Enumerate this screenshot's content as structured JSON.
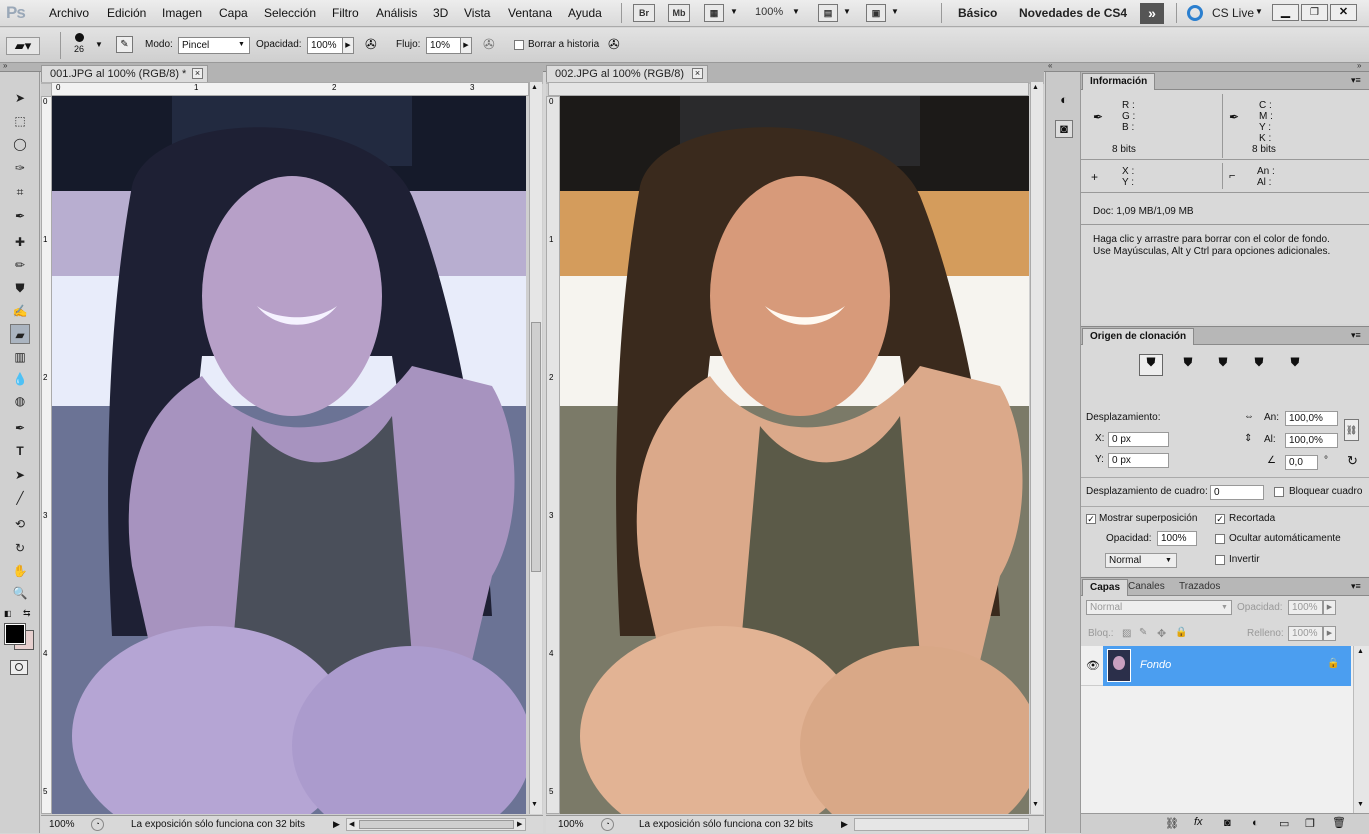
{
  "app": {
    "logo": "Ps"
  },
  "menu": [
    "Archivo",
    "Edición",
    "Imagen",
    "Capa",
    "Selección",
    "Filtro",
    "Análisis",
    "3D",
    "Vista",
    "Ventana",
    "Ayuda"
  ],
  "appbar": {
    "br_label": "Br",
    "mb_label": "Mb",
    "zoom": "100%",
    "workspace_basic": "Básico",
    "workspace_new": "Novedades de CS4",
    "cslive": "CS Live"
  },
  "options": {
    "brush_size": "26",
    "mode_label": "Modo:",
    "mode_value": "Pincel",
    "opacity_label": "Opacidad:",
    "opacity_value": "100%",
    "flow_label": "Flujo:",
    "flow_value": "10%",
    "history_label": "Borrar a historia"
  },
  "documents": [
    {
      "title": "001.JPG al 100% (RGB/8) *",
      "zoom": "100%",
      "status": "La exposición sólo funciona con 32 bits",
      "ruler_h": [
        "0",
        "1",
        "2",
        "3"
      ],
      "ruler_v": [
        "0",
        "1",
        "2",
        "3",
        "4",
        "5"
      ]
    },
    {
      "title": "002.JPG al 100% (RGB/8)",
      "zoom": "100%",
      "status": "La exposición sólo funciona con 32 bits",
      "ruler_h": [
        "0",
        "1",
        "2",
        "3"
      ],
      "ruler_v": [
        "0",
        "1",
        "2",
        "3",
        "4",
        "5"
      ]
    }
  ],
  "info_panel": {
    "tab": "Información",
    "rgb": [
      "R :",
      "G :",
      "B :"
    ],
    "bits_left": "8 bits",
    "cmyk": [
      "C :",
      "M :",
      "Y :",
      "K :"
    ],
    "bits_right": "8 bits",
    "xy": [
      "X :",
      "Y :"
    ],
    "size": [
      "An :",
      "Al :"
    ],
    "doc": "Doc: 1,09 MB/1,09 MB",
    "hint1": "Haga clic y arrastre para borrar con el color de fondo.",
    "hint2": "Use Mayúsculas, Alt y Ctrl para opciones adicionales."
  },
  "clone_panel": {
    "tab": "Origen de clonación",
    "offset_label": "Desplazamiento:",
    "x_label": "X:",
    "x_value": "0 px",
    "y_label": "Y:",
    "y_value": "0 px",
    "w_label": "An:",
    "w_value": "100,0%",
    "h_label": "Al:",
    "h_value": "100,0%",
    "angle_value": "0,0",
    "deg": "°",
    "frame_offset_label": "Desplazamiento de cuadro:",
    "frame_offset_value": "0",
    "lock_frame": "Bloquear cuadro",
    "show_overlay": "Mostrar superposición",
    "clipped": "Recortada",
    "opacity_label": "Opacidad:",
    "opacity_value": "100%",
    "auto_hide": "Ocultar automáticamente",
    "blend_value": "Normal",
    "invert": "Invertir"
  },
  "layers_panel": {
    "tabs": [
      "Capas",
      "Canales",
      "Trazados"
    ],
    "blend": "Normal",
    "opacity_label": "Opacidad:",
    "opacity_value": "100%",
    "lock_label": "Bloq.:",
    "fill_label": "Relleno:",
    "fill_value": "100%",
    "layer_name": "Fondo"
  },
  "colors": {
    "accent": "#3d8ee8",
    "layer_selected": "#4b9ef0"
  }
}
